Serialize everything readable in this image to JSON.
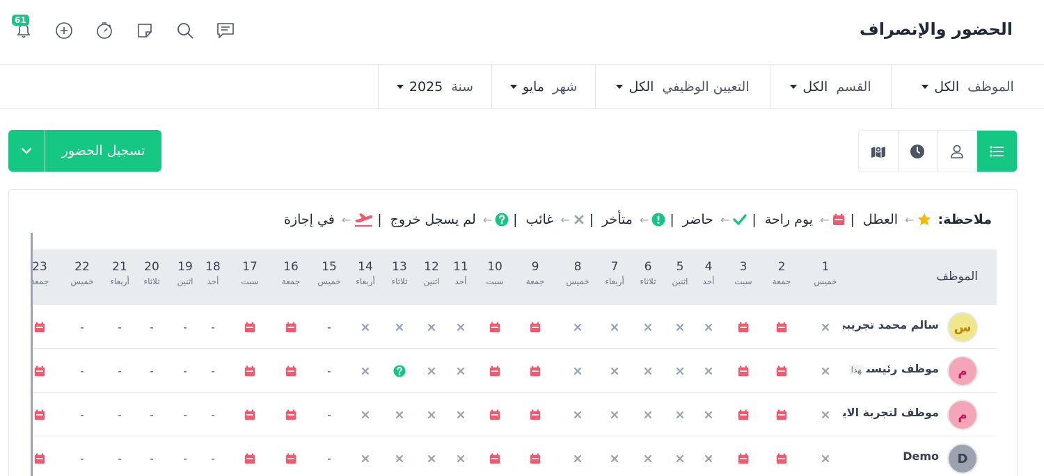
{
  "header": {
    "title": "الحضور والإنصراف",
    "notifications_count": "61",
    "icons": [
      "bell-icon",
      "plus-circle-icon",
      "timer-icon",
      "sticky-note-icon",
      "search-icon",
      "chat-icon"
    ]
  },
  "filters": [
    {
      "label": "الموظف",
      "value": "الكل"
    },
    {
      "label": "القسم",
      "value": "الكل"
    },
    {
      "label": "التعيين الوظيفي",
      "value": "الكل"
    },
    {
      "label": "شهر",
      "value": "مايو"
    },
    {
      "label": "سنة",
      "value": "2025"
    }
  ],
  "actions": {
    "record_label": "تسجيل الحضور"
  },
  "views": [
    "list-icon",
    "user-icon",
    "clock-icon",
    "map-icon"
  ],
  "legend": {
    "title": "ملاحظة:",
    "items": [
      {
        "label": "العطل",
        "icon": "star-icon"
      },
      {
        "label": "يوم راحة",
        "icon": "calendar-icon"
      },
      {
        "label": "حاضر",
        "icon": "check-icon"
      },
      {
        "label": "متأخر",
        "icon": "exclamation-icon"
      },
      {
        "label": "غائب",
        "icon": "x-icon"
      },
      {
        "label": "لم يسجل خروج",
        "icon": "question-icon"
      },
      {
        "label": "في إجازة",
        "icon": "plane-icon"
      }
    ]
  },
  "table": {
    "employee_header": "الموظف",
    "days": [
      {
        "num": "1",
        "name": "خميس"
      },
      {
        "num": "2",
        "name": "جمعة"
      },
      {
        "num": "3",
        "name": "سبت"
      },
      {
        "num": "4",
        "name": "أحد"
      },
      {
        "num": "5",
        "name": "اثنين"
      },
      {
        "num": "6",
        "name": "ثلاثاء"
      },
      {
        "num": "7",
        "name": "أربعاء"
      },
      {
        "num": "8",
        "name": "خميس"
      },
      {
        "num": "9",
        "name": "جمعة"
      },
      {
        "num": "10",
        "name": "سبت"
      },
      {
        "num": "11",
        "name": "أحد"
      },
      {
        "num": "12",
        "name": "اثنين"
      },
      {
        "num": "13",
        "name": "ثلاثاء"
      },
      {
        "num": "14",
        "name": "أربعاء"
      },
      {
        "num": "15",
        "name": "خميس"
      },
      {
        "num": "16",
        "name": "جمعة"
      },
      {
        "num": "17",
        "name": "سبت"
      },
      {
        "num": "18",
        "name": "أحد"
      },
      {
        "num": "19",
        "name": "اثنين"
      },
      {
        "num": "20",
        "name": "ثلاثاء"
      },
      {
        "num": "21",
        "name": "أربعاء"
      },
      {
        "num": "22",
        "name": "خميس"
      },
      {
        "num": "23",
        "name": "جمعة"
      }
    ],
    "rows": [
      {
        "name": "سالم محمد تجريبي",
        "tag": "",
        "avatar_letter": "س",
        "avatar_bg": "#f0e68c",
        "avatar_fg": "#b8860b",
        "cells": [
          "absent",
          "off",
          "off",
          "absent",
          "absent",
          "absent",
          "absent",
          "absent",
          "off",
          "off",
          "absent",
          "absent",
          "absent",
          "absent",
          "none",
          "off",
          "off",
          "none",
          "none",
          "none",
          "none",
          "none",
          "off"
        ]
      },
      {
        "name": "موظف رئيسى",
        "tag": "هذا",
        "avatar_letter": "م",
        "avatar_bg": "#f4a6b8",
        "avatar_fg": "#c2185b",
        "cells": [
          "absent",
          "off",
          "off",
          "absent",
          "absent",
          "absent",
          "absent",
          "absent",
          "off",
          "off",
          "absent",
          "absent",
          "noout",
          "absent",
          "none",
          "off",
          "off",
          "none",
          "none",
          "none",
          "none",
          "none",
          "off"
        ]
      },
      {
        "name": "موظف لتجربة الايميل",
        "tag": "",
        "avatar_letter": "م",
        "avatar_bg": "#f4a6b8",
        "avatar_fg": "#c2185b",
        "cells": [
          "absent",
          "off",
          "off",
          "absent",
          "absent",
          "absent",
          "absent",
          "absent",
          "off",
          "off",
          "absent",
          "absent",
          "absent",
          "absent",
          "none",
          "off",
          "off",
          "none",
          "none",
          "none",
          "none",
          "none",
          "off"
        ]
      },
      {
        "name": "Demo",
        "tag": "",
        "avatar_letter": "D",
        "avatar_bg": "#9ca3af",
        "avatar_fg": "#374151",
        "cells": [
          "absent",
          "off",
          "off",
          "absent",
          "absent",
          "absent",
          "absent",
          "absent",
          "off",
          "off",
          "absent",
          "absent",
          "absent",
          "absent",
          "none",
          "off",
          "off",
          "none",
          "none",
          "none",
          "none",
          "none",
          "off"
        ]
      }
    ]
  },
  "colors": {
    "accent": "#16c784",
    "off": "#ef5a6f",
    "absent": "#9ca3af",
    "star": "#f5b800",
    "warning": "#16c784"
  }
}
